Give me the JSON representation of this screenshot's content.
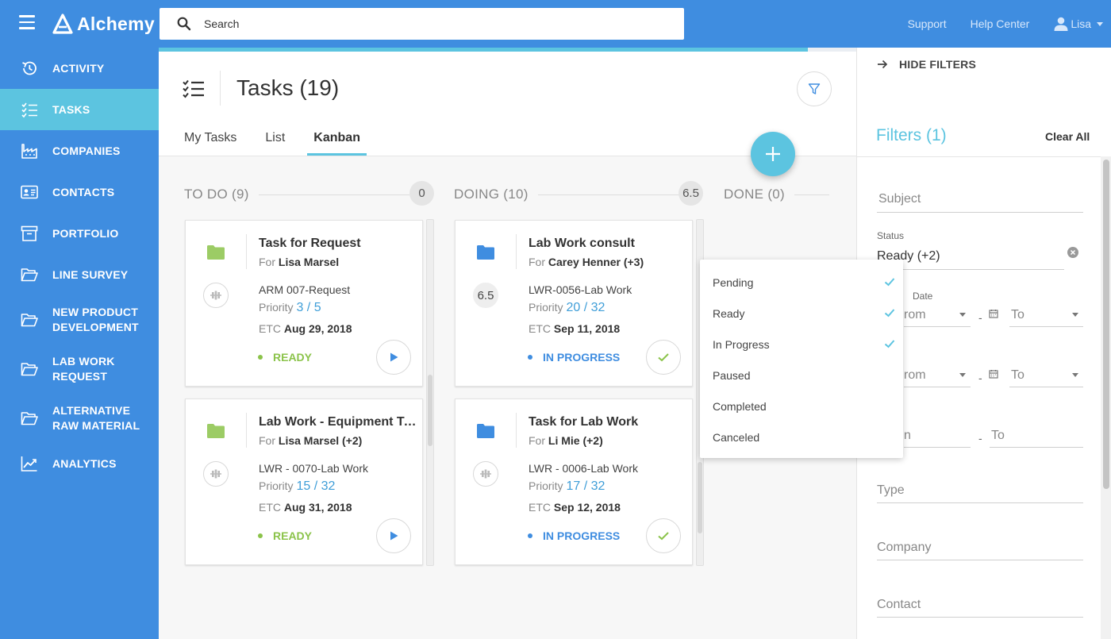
{
  "app": {
    "name": "Alchemy"
  },
  "topbar": {
    "search_placeholder": "Search",
    "links": [
      "Support",
      "Help Center"
    ],
    "user": "Lisa"
  },
  "sidebar": {
    "items": [
      {
        "label": "ACTIVITY",
        "icon": "history-icon"
      },
      {
        "label": "TASKS",
        "icon": "tasks-icon",
        "active": true
      },
      {
        "label": "COMPANIES",
        "icon": "factory-icon"
      },
      {
        "label": "CONTACTS",
        "icon": "contact-card-icon"
      },
      {
        "label": "PORTFOLIO",
        "icon": "archive-icon"
      },
      {
        "label": "LINE SURVEY",
        "icon": "folder-open-icon"
      },
      {
        "label": "NEW PRODUCT DEVELOPMENT",
        "icon": "folder-open-icon"
      },
      {
        "label": "LAB WORK REQUEST",
        "icon": "folder-open-icon"
      },
      {
        "label": "ALTERNATIVE RAW MATERIAL",
        "icon": "folder-open-icon"
      },
      {
        "label": "ANALYTICS",
        "icon": "trending-up-icon"
      }
    ]
  },
  "page": {
    "title": "Tasks (19)",
    "tabs": [
      "My Tasks",
      "List",
      "Kanban"
    ],
    "active_tab": "Kanban",
    "progress": 0.93
  },
  "columns": [
    {
      "title": "TO DO (9)",
      "count": "0"
    },
    {
      "title": "DOING (10)",
      "count": "6.5"
    },
    {
      "title": "DONE (0)"
    }
  ],
  "cards": [
    {
      "title": "Task for Request",
      "for_label": "For",
      "for_name": "Lisa Marsel",
      "ref": "ARM 007-Request",
      "priority_label": "Priority",
      "priority": "3",
      "priority_total": "5",
      "etc_label": "ETC",
      "etc": "Aug 29, 2018",
      "status": "READY",
      "folder_color": "#9ccc65",
      "badge": ""
    },
    {
      "title": "Lab Work - Equipment Tabletop",
      "for_label": "For",
      "for_name": "Lisa Marsel (+2)",
      "ref": "LWR - 0070-Lab Work",
      "priority_label": "Priority",
      "priority": "15",
      "priority_total": "32",
      "etc_label": "ETC",
      "etc": "Aug 31, 2018",
      "status": "READY",
      "folder_color": "#9ccc65",
      "badge": ""
    },
    {
      "title": "Lab Work consult",
      "for_label": "For",
      "for_name": "Carey Henner (+3)",
      "ref": "LWR-0056-Lab Work",
      "priority_label": "Priority",
      "priority": "20",
      "priority_total": "32",
      "etc_label": "ETC",
      "etc": "Sep 11, 2018",
      "status": "IN PROGRESS",
      "folder_color": "#3f8de0",
      "badge": "6.5"
    },
    {
      "title": "Task for Lab Work",
      "for_label": "For",
      "for_name": "Li Mie (+2)",
      "ref": "LWR - 0006-Lab Work",
      "priority_label": "Priority",
      "priority": "17",
      "priority_total": "32",
      "etc_label": "ETC",
      "etc": "Sep 12, 2018",
      "status": "IN PROGRESS",
      "folder_color": "#3f8de0",
      "badge": ""
    }
  ],
  "filters": {
    "hide_label": "HIDE FILTERS",
    "title": "Filters (1)",
    "clear_all": "Clear All",
    "subject_placeholder": "Subject",
    "status_label": "Status",
    "status_value": "Ready (+2)",
    "date_label_fragment": "Date",
    "from_fragment": "rom",
    "to_placeholder": "To",
    "range3_from_fragment": "n",
    "dash": "-",
    "type_placeholder": "Type",
    "company_placeholder": "Company",
    "contact_placeholder": "Contact"
  },
  "status_options": [
    {
      "label": "Pending",
      "checked": true
    },
    {
      "label": "Ready",
      "checked": true
    },
    {
      "label": "In Progress",
      "checked": true
    },
    {
      "label": "Paused",
      "checked": false
    },
    {
      "label": "Completed",
      "checked": false
    },
    {
      "label": "Canceled",
      "checked": false
    }
  ],
  "colors": {
    "primary": "#3f8de0",
    "accent": "#5cc4e0",
    "ready": "#8bc34a",
    "in_progress": "#3f8de0"
  }
}
